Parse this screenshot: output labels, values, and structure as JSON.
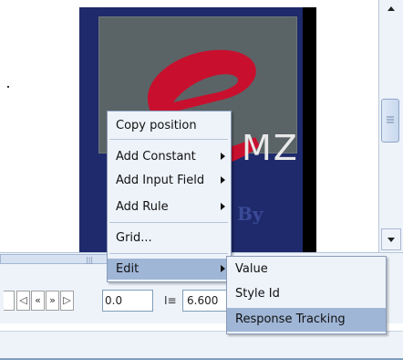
{
  "canvas": {
    "logo_text": "MZ",
    "logo_by": "By"
  },
  "toolbar": {
    "time_value": "0.0",
    "size_value": "6.600",
    "nav": [
      "◁",
      "«",
      "»",
      "▷"
    ]
  },
  "context_menu": {
    "items": [
      {
        "label": "Copy position",
        "submenu": false
      },
      {
        "label": "Add Constant",
        "submenu": true
      },
      {
        "label": "Add Input Field",
        "submenu": true
      },
      {
        "label": "Add Rule",
        "submenu": true
      },
      {
        "label": "Grid...",
        "submenu": false
      },
      {
        "label": "Edit",
        "submenu": true,
        "highlighted": true
      }
    ]
  },
  "edit_submenu": {
    "items": [
      {
        "label": "Value"
      },
      {
        "label": "Style Id"
      },
      {
        "label": "Response Tracking",
        "highlighted": true
      }
    ]
  },
  "colors": {
    "panel_blue": "#1e2a6b",
    "logo_red": "#c8102e",
    "menu_bg": "#eef3fa",
    "highlight": "#9fb6d6"
  }
}
